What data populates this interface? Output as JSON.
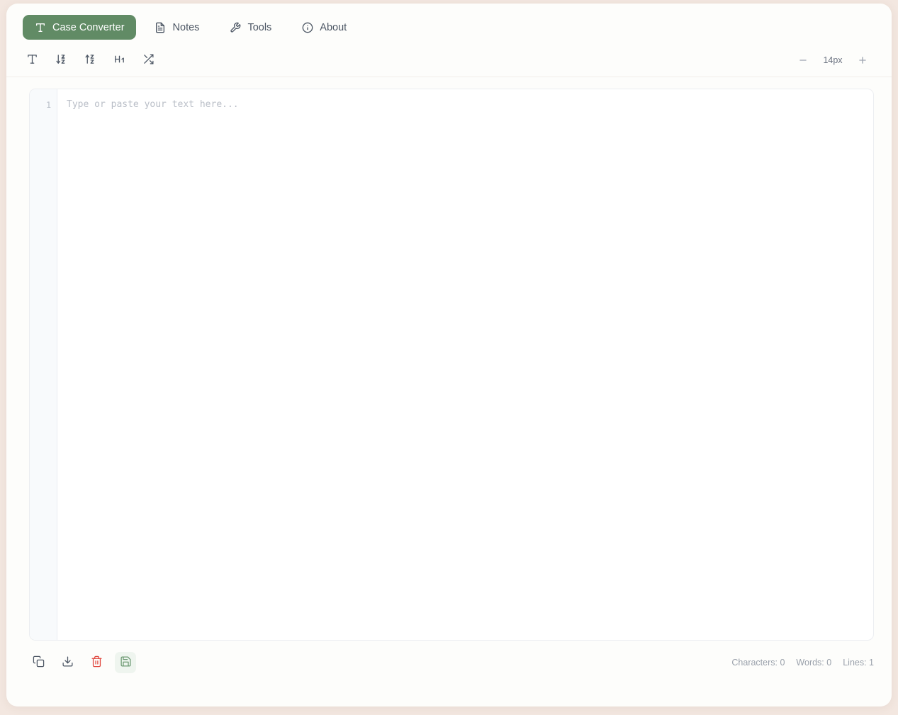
{
  "theme": {
    "page_background": "#f3e7e0",
    "card_background": "#fdfdfb",
    "accent_green": "#618b65",
    "danger_red": "#e0453c",
    "save_green": "#6d9a73"
  },
  "tabs": [
    {
      "label": "Case Converter",
      "icon": "type-icon",
      "active": true
    },
    {
      "label": "Notes",
      "icon": "file-text-icon",
      "active": false
    },
    {
      "label": "Tools",
      "icon": "wrench-icon",
      "active": false
    },
    {
      "label": "About",
      "icon": "info-circle-icon",
      "active": false
    }
  ],
  "toolbar": {
    "tools": [
      {
        "name": "text-format-icon",
        "title": "Text"
      },
      {
        "name": "sort-az-desc-icon",
        "title": "Sort A-Z Descending"
      },
      {
        "name": "sort-az-asc-icon",
        "title": "Sort A-Z Ascending"
      },
      {
        "name": "heading-1-icon",
        "title": "Heading 1"
      },
      {
        "name": "shuffle-icon",
        "title": "Shuffle"
      }
    ],
    "font_size": {
      "decrease_label": "−",
      "value": "14px",
      "increase_label": "+"
    }
  },
  "editor": {
    "placeholder": "Type or paste your text here...",
    "value": "",
    "line_numbers": [
      "1"
    ]
  },
  "footer": {
    "actions": [
      {
        "name": "copy-button",
        "icon": "copy-icon",
        "style": "normal"
      },
      {
        "name": "download-button",
        "icon": "download-icon",
        "style": "normal"
      },
      {
        "name": "delete-button",
        "icon": "trash-icon",
        "style": "danger"
      },
      {
        "name": "save-button",
        "icon": "save-icon",
        "style": "save"
      }
    ],
    "stats": {
      "characters": "Characters: 0",
      "words": "Words: 0",
      "lines": "Lines: 1"
    }
  }
}
